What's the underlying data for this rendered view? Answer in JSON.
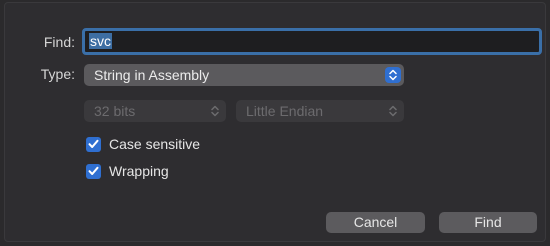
{
  "labels": {
    "find": "Find:",
    "type": "Type:"
  },
  "find_field": {
    "value": "svc"
  },
  "type_popup": {
    "selected": "String in Assembly"
  },
  "bits_popup": {
    "selected": "32 bits"
  },
  "endian_popup": {
    "selected": "Little Endian"
  },
  "options": [
    {
      "label": "Case sensitive",
      "checked": true
    },
    {
      "label": "Wrapping",
      "checked": true
    }
  ],
  "buttons": {
    "cancel": "Cancel",
    "find": "Find"
  },
  "colors": {
    "accent": "#2f6fd1",
    "focus_ring": "#3a6fa8",
    "background": "#2e2d30",
    "button": "#5c5b5e"
  },
  "icons": {
    "stepper": "up-down-chevron-icon",
    "check": "checkmark-icon"
  }
}
